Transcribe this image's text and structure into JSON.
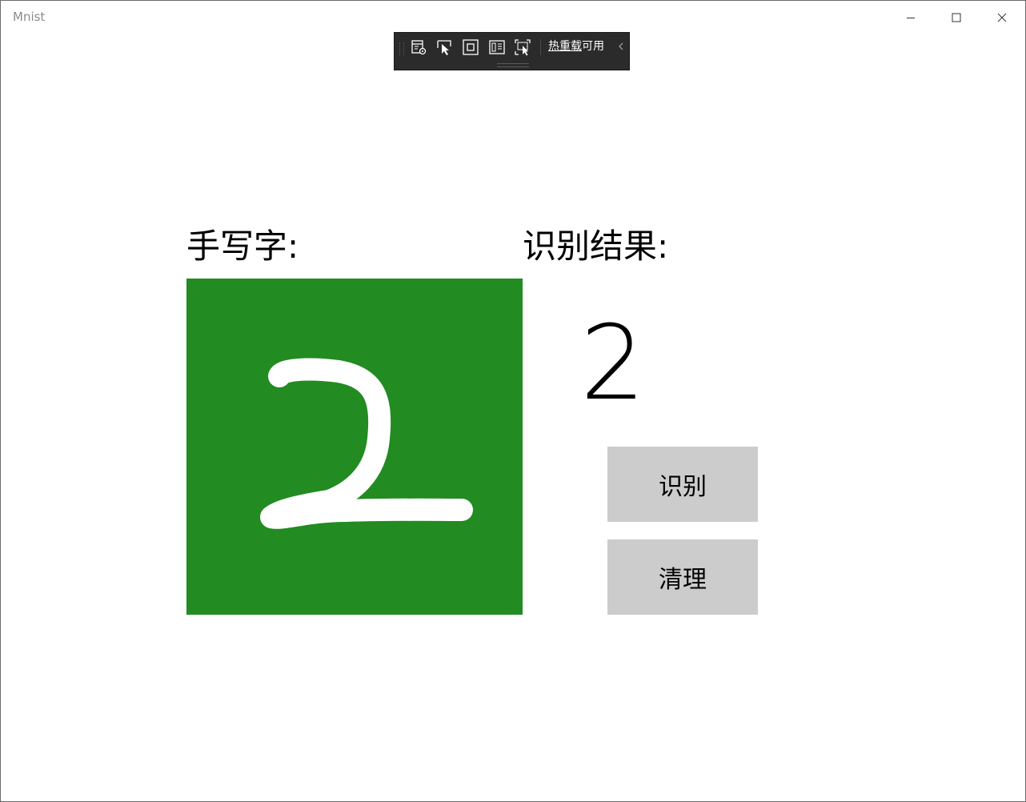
{
  "window": {
    "title": "Mnist"
  },
  "devtools": {
    "hot_reload_link": "热重载",
    "hot_reload_suffix": "可用",
    "tools": [
      "live-visual-tree-icon",
      "select-element-icon",
      "display-layout-adorners-icon",
      "track-focused-element-icon",
      "show-binding-failures-icon"
    ]
  },
  "main": {
    "handwriting_label": "手写字:",
    "result_label": "识别结果:",
    "result_value": "2",
    "canvas_color": "#228b22",
    "ink_color": "#ffffff",
    "recognize_button": "识别",
    "clear_button": "清理"
  }
}
